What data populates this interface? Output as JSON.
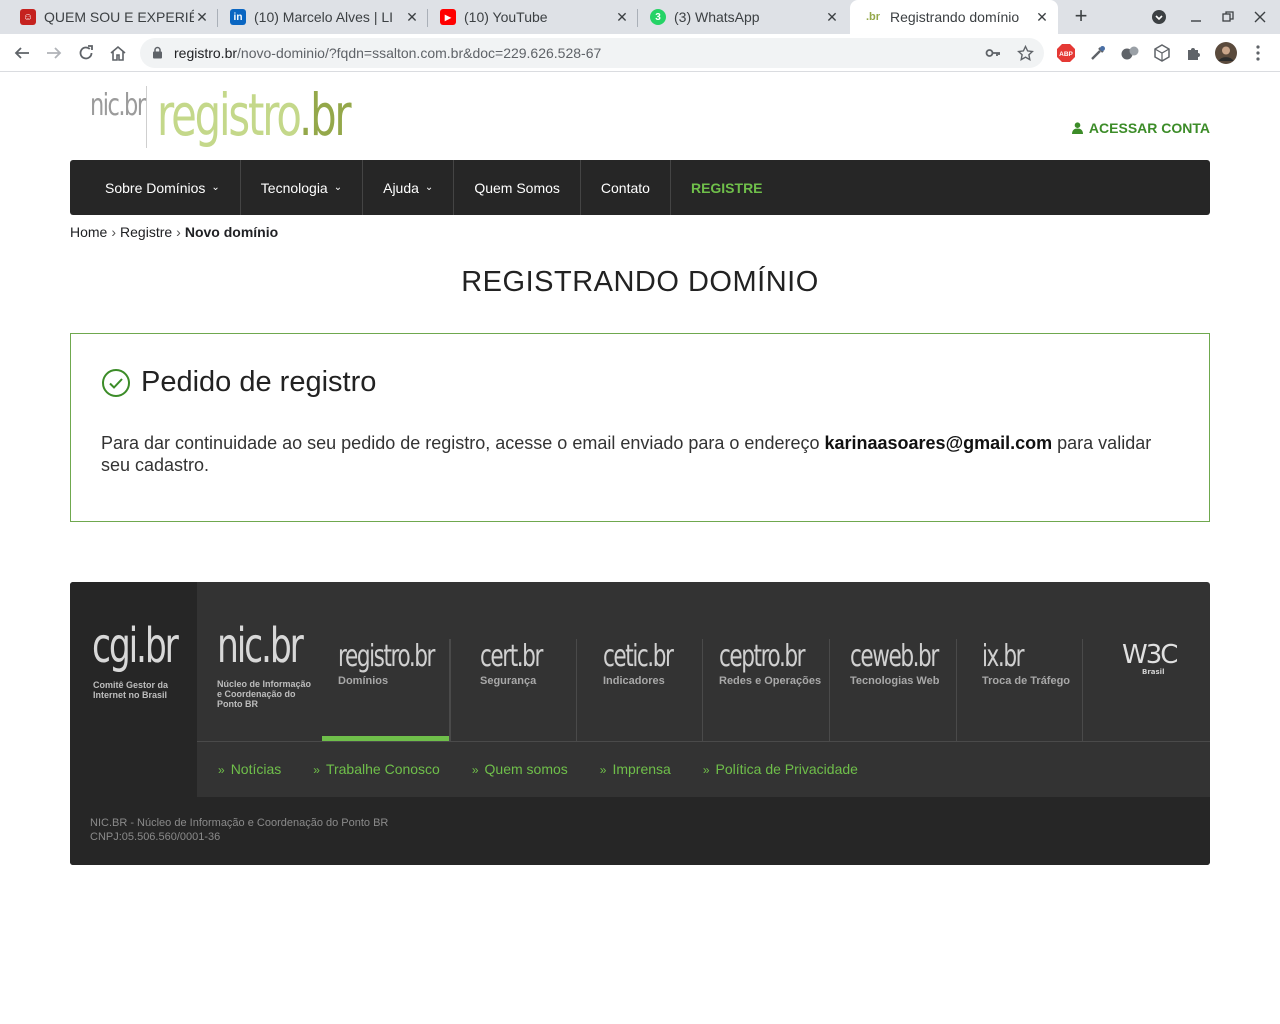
{
  "browser": {
    "tabs": [
      {
        "title": "QUEM SOU E EXPERIÊ",
        "fav_bg": "#c5221f",
        "fav_glyph": "☺"
      },
      {
        "title": "(10) Marcelo Alves | LI",
        "fav_bg": "#0a66c2",
        "fav_glyph": "in"
      },
      {
        "title": "(10) YouTube",
        "fav_bg": "#ff0000",
        "fav_glyph": "▶"
      },
      {
        "title": "(3) WhatsApp",
        "fav_bg": "#25d366",
        "fav_glyph": "3"
      },
      {
        "title": "Registrando domínio",
        "fav_bg": "#ffffff",
        "fav_glyph": ".br"
      }
    ],
    "url_host": "registro.br",
    "url_path": "/novo-dominio/?fqdn=ssalton.com.br&doc=229.626.528-67",
    "new_tab_label": "+",
    "abp_label": "ABP"
  },
  "header": {
    "logo_nic": "nic.br",
    "logo_registro_a": "registro",
    "logo_registro_b": ".br",
    "account_label": "ACESSAR CONTA",
    "accent": "#3c8c28"
  },
  "nav": {
    "items": [
      {
        "label": "Sobre Domínios",
        "has_menu": true
      },
      {
        "label": "Tecnologia",
        "has_menu": true
      },
      {
        "label": "Ajuda",
        "has_menu": true
      },
      {
        "label": "Quem Somos",
        "has_menu": false
      },
      {
        "label": "Contato",
        "has_menu": false
      }
    ],
    "highlight_label": "REGISTRE"
  },
  "breadcrumb": {
    "home": "Home",
    "registre": "Registre",
    "current": "Novo domínio"
  },
  "page_title": "REGISTRANDO DOMÍNIO",
  "notice": {
    "title": "Pedido de registro",
    "text_before": "Para dar continuidade ao seu pedido de registro, acesse o email enviado para o endereço ",
    "email": "karinaasoares@gmail.com",
    "text_after": " para validar seu cadastro."
  },
  "footer": {
    "cgi_name": "cgi.br",
    "cgi_sub_1": "Comitê Gestor da",
    "cgi_sub_2": "Internet no Brasil",
    "nic_name": "nic.br",
    "nic_sub_1": "Núcleo de Informação",
    "nic_sub_2": "e Coordenação do",
    "nic_sub_3": "Ponto BR",
    "brands": [
      {
        "name": "registro.br",
        "sub": "Domínios",
        "selected": true
      },
      {
        "name": "cert.br",
        "sub": "Segurança",
        "selected": false
      },
      {
        "name": "cetic.br",
        "sub": "Indicadores",
        "selected": false
      },
      {
        "name": "ceptro.br",
        "sub": "Redes e Operações",
        "selected": false
      },
      {
        "name": "ceweb.br",
        "sub": "Tecnologias Web",
        "selected": false
      },
      {
        "name": "ix.br",
        "sub": "Troca de Tráfego",
        "selected": false
      }
    ],
    "w3c": "W3C",
    "w3c_sub": "Brasil",
    "links": [
      "Notícias",
      "Trabalhe Conosco",
      "Quem somos",
      "Imprensa",
      "Política de Privacidade"
    ],
    "legal_1": "NIC.BR - Núcleo de Informação e Coordenação do Ponto BR",
    "legal_2": "CNPJ:05.506.560/0001-36"
  }
}
